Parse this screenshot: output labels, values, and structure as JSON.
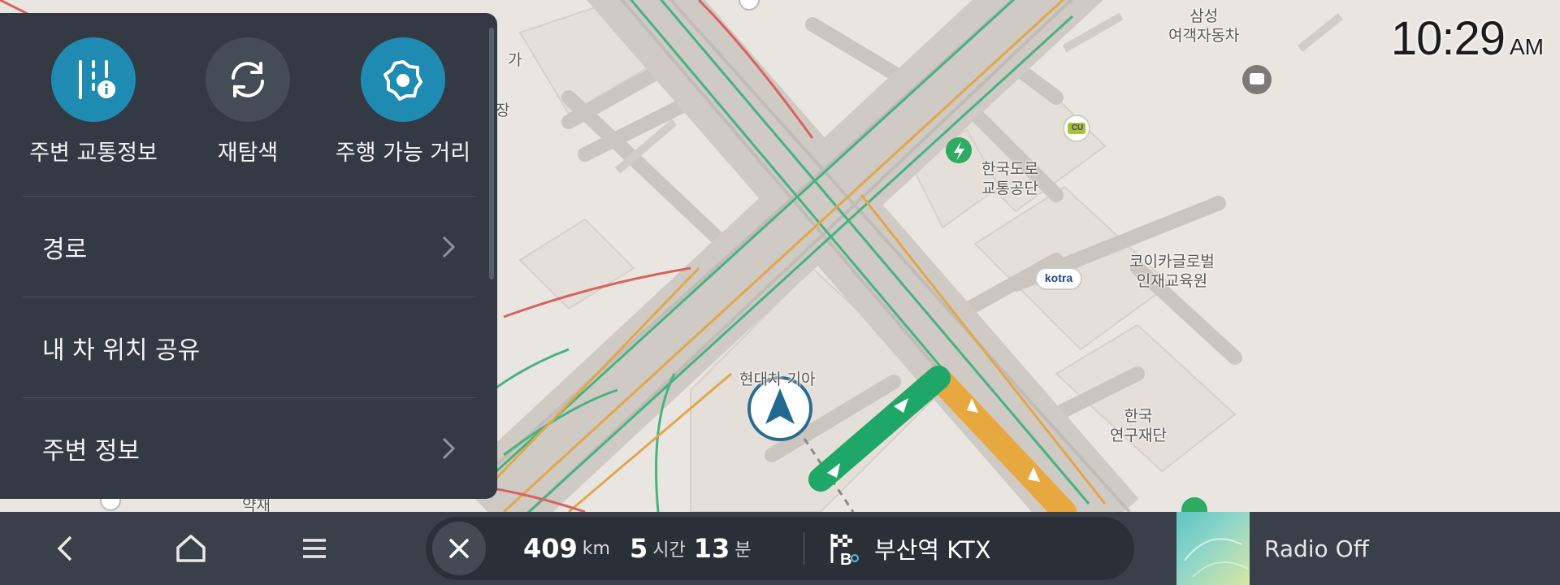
{
  "clock": {
    "time": "10:29",
    "ampm": "AM"
  },
  "map": {
    "labels": [
      {
        "id": "samsung",
        "text": "삼성\n여객자동차"
      },
      {
        "id": "kec",
        "text": "한국도로\n교통공단"
      },
      {
        "id": "koica",
        "text": "코이카글로벌\n인재교육원"
      },
      {
        "id": "hyundai",
        "text": "현대차 기아"
      },
      {
        "id": "kr",
        "text": "한국\n연구재단"
      },
      {
        "id": "ga",
        "text": "가"
      },
      {
        "id": "jang",
        "text": "장"
      },
      {
        "id": "yakjae",
        "text": "약재"
      }
    ],
    "poi_cu": "CU",
    "poi_kotra": "kotra"
  },
  "menu": {
    "quick": [
      {
        "label": "주변 교통정보",
        "icon": "traffic-info-icon"
      },
      {
        "label": "재탐색",
        "icon": "reroute-icon"
      },
      {
        "label": "주행 가능 거리",
        "icon": "range-icon"
      }
    ],
    "rows": [
      {
        "label": "경로",
        "has_arrow": true
      },
      {
        "label": "내 차 위치 공유",
        "has_arrow": false
      },
      {
        "label": "주변 정보",
        "has_arrow": true
      }
    ]
  },
  "bottom_bar": {
    "distance_value": "409",
    "distance_unit": "km",
    "hours_value": "5",
    "hours_unit": "시간",
    "minutes_value": "13",
    "minutes_unit": "분",
    "destination": "부산역 KTX",
    "destination_badge": "B",
    "radio": "Radio Off"
  },
  "colors": {
    "accent_blue": "#1f8bb3",
    "route_green": "#1fa76a",
    "route_orange": "#e8a840",
    "panel_bg": "#333a44",
    "bar_bg": "#3a4049"
  }
}
